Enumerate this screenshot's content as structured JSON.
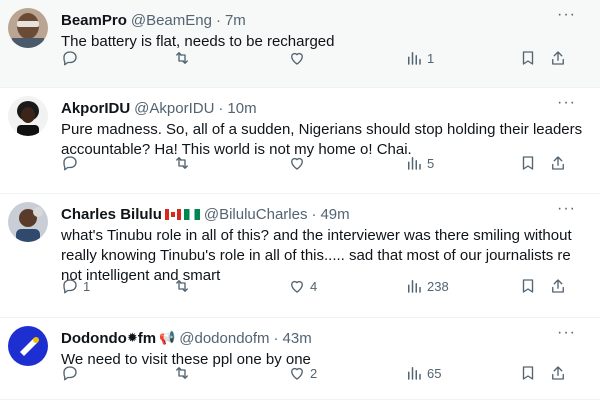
{
  "tweets": [
    {
      "name": "BeamPro",
      "handle": "@BeamEng",
      "time": "7m",
      "text": "The battery is flat, needs to be recharged",
      "replies": "",
      "retweets": "",
      "likes": "",
      "views": "1"
    },
    {
      "name": "AkporIDU",
      "handle": "@AkporIDU",
      "time": "10m",
      "text": "Pure madness. So, all of a sudden, Nigerians should stop holding their leaders accountable? Ha! This world is not my home o! Chai.",
      "replies": "",
      "retweets": "",
      "likes": "",
      "views": "5"
    },
    {
      "name": "Charles Bilulu",
      "handle": "@BiluluCharles",
      "time": "49m",
      "text": "what's Tinubu role in all of this? and the interviewer was there smiling without really knowing Tinubu's role in all of this..... sad that most of our journalists re not intelligent and smart",
      "replies": "1",
      "retweets": "",
      "likes": "4",
      "views": "238"
    },
    {
      "name": "Dodondo",
      "name_suffix": "fm",
      "handle": "@dodondofm",
      "time": "43m",
      "text": "We need to visit these ppl one by one",
      "replies": "",
      "retweets": "",
      "likes": "2",
      "views": "65"
    }
  ],
  "ui": {
    "separator": "·",
    "more_glyph": "···"
  },
  "icons": {
    "reply": "reply-icon",
    "retweet": "retweet-icon",
    "like": "like-icon",
    "views": "views-icon",
    "bookmark": "bookmark-icon",
    "share": "share-icon",
    "more": "more-icon"
  },
  "colors": {
    "text": "#0f1419",
    "secondary": "#536471",
    "divider": "#eff3f4",
    "hover_bg": "#f7f9f9"
  }
}
